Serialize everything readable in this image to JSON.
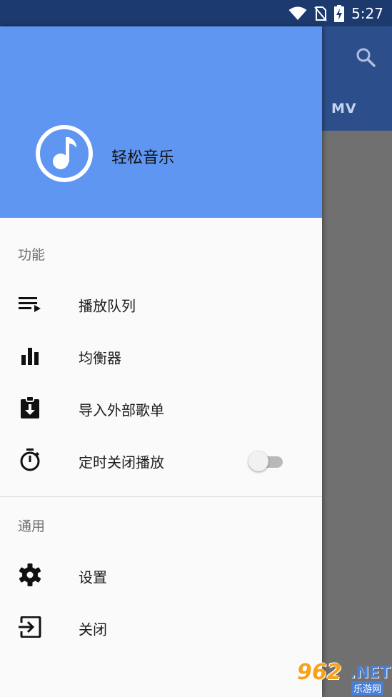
{
  "status_bar": {
    "time": "5:27",
    "icons": [
      "wifi-icon",
      "no-sim-icon",
      "battery-charging-icon"
    ]
  },
  "background_app": {
    "tab_label": "MV",
    "search_icon": "search-icon"
  },
  "drawer": {
    "header": {
      "app_name": "轻松音乐",
      "logo_icon": "music-note-icon",
      "color": "#5f96f2"
    },
    "sections": [
      {
        "title": "功能",
        "items": [
          {
            "label": "播放队列",
            "icon": "queue-music-icon"
          },
          {
            "label": "均衡器",
            "icon": "equalizer-icon"
          },
          {
            "label": "导入外部歌单",
            "icon": "import-playlist-icon"
          },
          {
            "label": "定时关闭播放",
            "icon": "timer-icon",
            "toggle": false
          }
        ]
      },
      {
        "title": "通用",
        "items": [
          {
            "label": "设置",
            "icon": "gear-icon"
          },
          {
            "label": "关闭",
            "icon": "exit-icon"
          }
        ]
      }
    ]
  },
  "watermark": {
    "number": "962",
    "suffix": ".NET",
    "subtitle": "乐游网"
  }
}
